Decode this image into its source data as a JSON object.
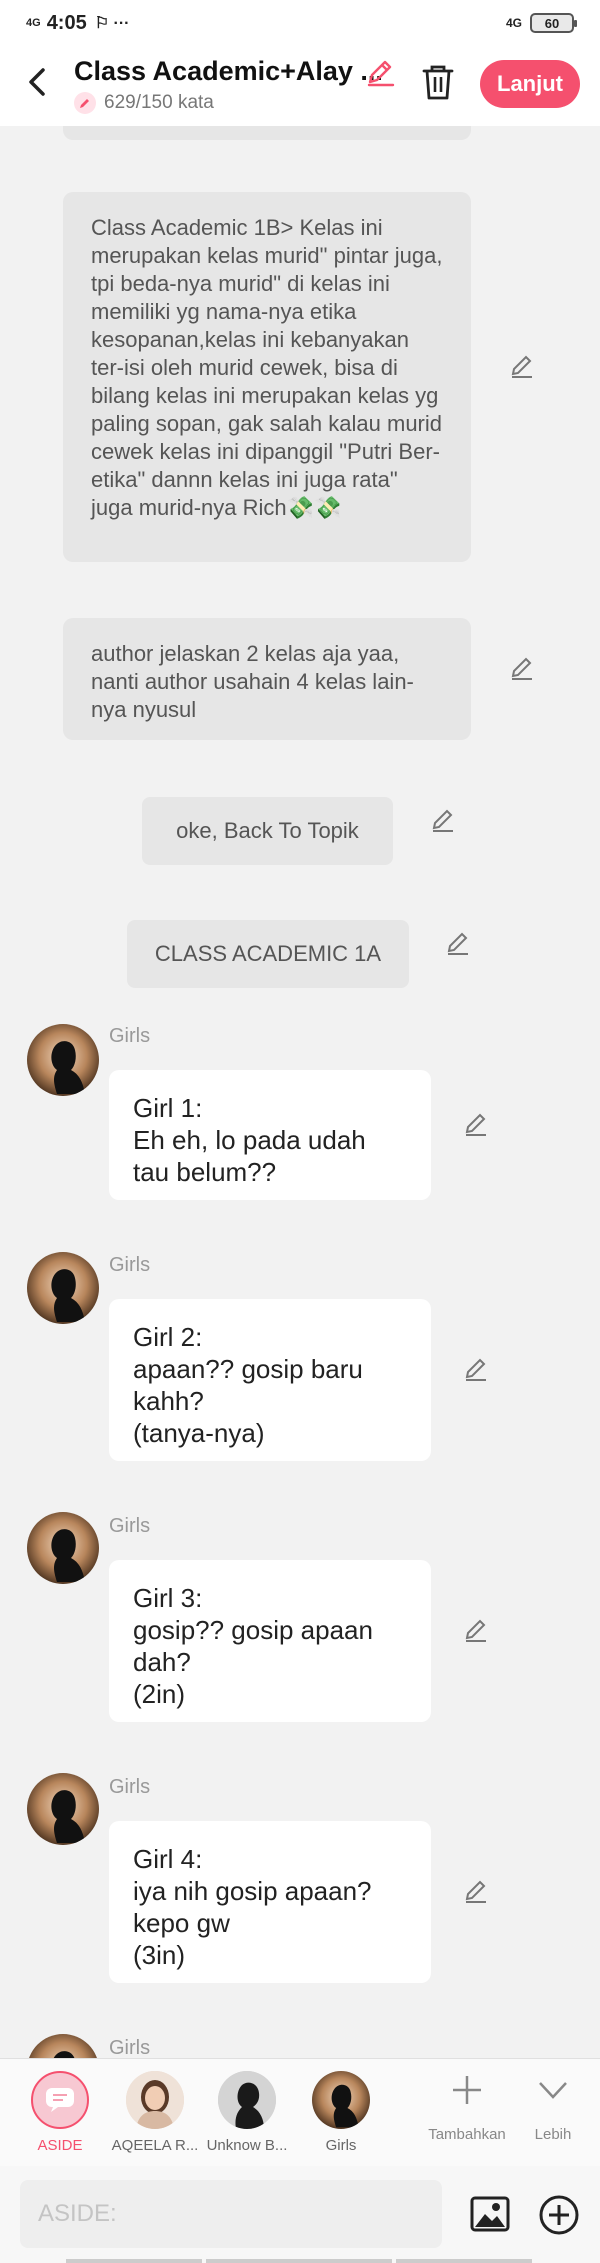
{
  "status": {
    "time": "4:05",
    "network_left": "4G",
    "network_right": "4G",
    "battery": "60"
  },
  "header": {
    "title": "Class Academic+Alay ...",
    "word_count": "629/150 kata",
    "next_label": "Lanjut"
  },
  "messages": {
    "aside1": "Class Academic 1B> Kelas ini merupakan kelas murid\" pintar juga, tpi beda-nya murid\" di kelas ini memiliki yg nama-nya etika kesopanan,kelas ini kebanyakan ter-isi oleh murid cewek, bisa di bilang kelas ini merupakan kelas yg paling sopan, gak salah kalau murid cewek kelas ini dipanggil \"Putri Ber-etika\" dannn kelas ini juga rata\" juga murid-nya Rich💸💸",
    "aside2": "author jelaskan 2 kelas aja yaa, nanti author usahain 4 kelas lain-nya nyusul",
    "pill1": "oke, Back To Topik",
    "pill2": "CLASS ACADEMIC 1A",
    "chats": [
      {
        "name": "Girls",
        "text": "Girl 1:\nEh eh, lo pada udah tau belum??"
      },
      {
        "name": "Girls",
        "text": "Girl 2:\napaan?? gosip baru kahh?\n(tanya-nya)"
      },
      {
        "name": "Girls",
        "text": "Girl 3:\ngosip?? gosip apaan dah?\n(2in)"
      },
      {
        "name": "Girls",
        "text": "Girl 4:\niya nih gosip apaan? kepo gw\n(3in)"
      },
      {
        "name": "Girls",
        "text": ""
      }
    ]
  },
  "characters": [
    {
      "label": "ASIDE"
    },
    {
      "label": "AQEELA R..."
    },
    {
      "label": "Unknow B..."
    },
    {
      "label": "Girls"
    }
  ],
  "tools": {
    "add_label": "Tambahkan",
    "more_label": "Lebih"
  },
  "input": {
    "placeholder": "ASIDE:"
  },
  "colors": {
    "accent": "#f5506e",
    "background": "#f2f2f2",
    "aside_bubble": "#e6e6e6"
  }
}
